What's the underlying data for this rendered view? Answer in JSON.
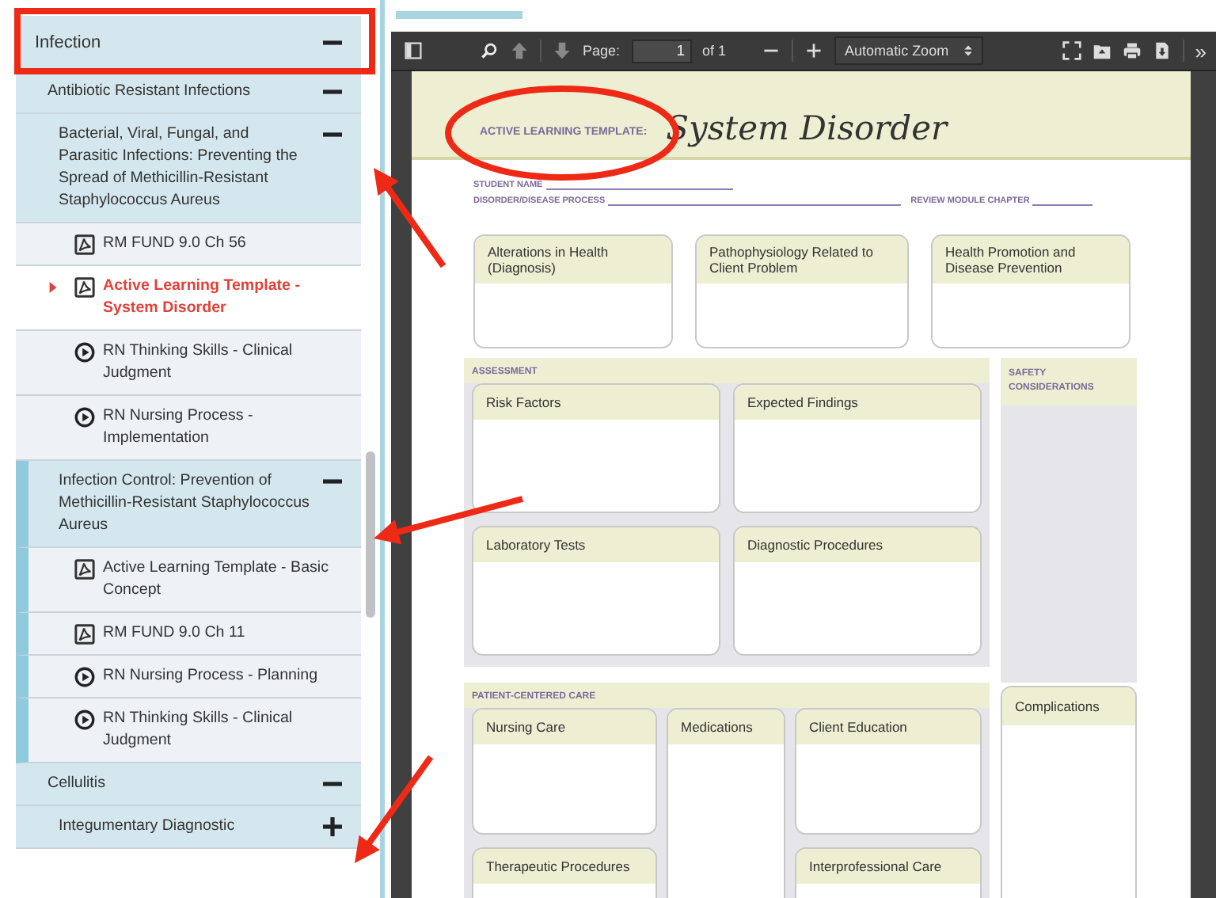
{
  "sidebar": {
    "items": [
      {
        "label": "Infection",
        "expanded": true,
        "focused": false,
        "children": [
          {
            "label": "Antibiotic Resistant Infections",
            "expanded": true,
            "focused": false,
            "children": [
              {
                "label": "Bacterial, Viral, Fungal, and Parasitic Infections: Preventing the Spread of Methicillin-Resistant Staphylococcus Aureus",
                "expanded": true,
                "focused": false,
                "children": [
                  {
                    "label": "RM FUND 9.0 Ch 56",
                    "kind": "pdf",
                    "selected": false
                  },
                  {
                    "label": "Active Learning Template - System Disorder",
                    "kind": "pdf",
                    "selected": true
                  },
                  {
                    "label": "RN Thinking Skills - Clinical Judgment",
                    "kind": "video",
                    "selected": false
                  },
                  {
                    "label": "RN Nursing Process - Implementation",
                    "kind": "video",
                    "selected": false
                  }
                ]
              },
              {
                "label": "Infection Control: Prevention of Methicillin-Resistant Staphylococcus Aureus",
                "expanded": true,
                "focused": true,
                "children": [
                  {
                    "label": "Active Learning Template - Basic Concept",
                    "kind": "pdf",
                    "selected": false
                  },
                  {
                    "label": "RM FUND 9.0 Ch 11",
                    "kind": "pdf",
                    "selected": false
                  },
                  {
                    "label": "RN Nursing Process - Planning",
                    "kind": "video",
                    "selected": false
                  },
                  {
                    "label": "RN Thinking Skills - Clinical Judgment",
                    "kind": "video",
                    "selected": false
                  }
                ]
              }
            ]
          },
          {
            "label": "Cellulitis",
            "expanded": true,
            "focused": false,
            "children": [
              {
                "label": "Integumentary Diagnostic",
                "expanded": false,
                "focused": false
              }
            ]
          }
        ]
      }
    ]
  },
  "viewer": {
    "toolbar": {
      "page_label": "Page:",
      "page": "1",
      "page_count": "of 1",
      "zoom": "Automatic Zoom",
      "more": "»"
    },
    "document": {
      "kicker": "ACTIVE LEARNING TEMPLATE:",
      "title": "System Disorder",
      "fields": [
        {
          "label": "STUDENT NAME"
        },
        {
          "label": "DISORDER/DISEASE PROCESS"
        },
        {
          "label": "REVIEW MODULE CHAPTER"
        }
      ],
      "top_boxes": [
        "Alterations in Health (Diagnosis)",
        "Pathophysiology Related to Client Problem",
        "Health Promotion and Disease Prevention"
      ],
      "assessment": {
        "heading": "ASSESSMENT",
        "boxes": [
          "Risk Factors",
          "Expected Findings",
          "Laboratory Tests",
          "Diagnostic Procedures"
        ]
      },
      "safety": {
        "heading": "SAFETY CONSIDERATIONS"
      },
      "care": {
        "heading": "PATIENT-CENTERED CARE",
        "boxes": [
          "Nursing Care",
          "Medications",
          "Client Education",
          "Therapeutic Procedures",
          "Interprofessional Care"
        ]
      },
      "complications": "Complications"
    }
  },
  "annotations": [
    {
      "kind": "rectangle"
    },
    {
      "kind": "ellipse"
    },
    {
      "kind": "arrow"
    },
    {
      "kind": "arrow"
    },
    {
      "kind": "arrow"
    }
  ]
}
